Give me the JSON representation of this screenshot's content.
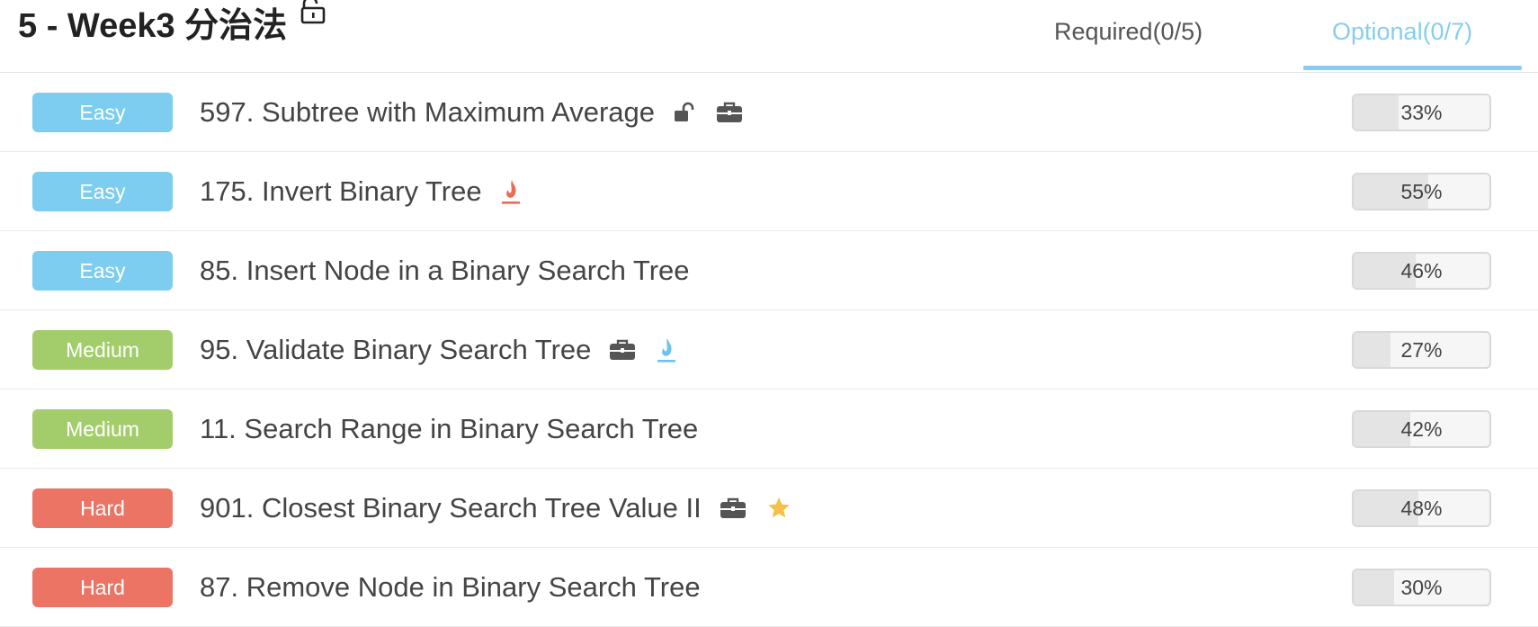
{
  "header": {
    "title": "5 - Week3 分治法",
    "tabs": [
      {
        "label": "Required(0/5)",
        "active": false
      },
      {
        "label": "Optional(0/7)",
        "active": true
      }
    ]
  },
  "colors": {
    "easy": "#7ccdf0",
    "medium": "#a2cd6a",
    "hard": "#ec7464",
    "accent": "#86cdf0",
    "flame_red": "#ec6a58",
    "flame_blue": "#6ec3ee",
    "star": "#f3c14a",
    "icon_dark": "#555555"
  },
  "problems": [
    {
      "difficulty": "Easy",
      "title": "597. Subtree with Maximum Average",
      "icons": [
        "lock-open-icon",
        "briefcase-icon"
      ],
      "acceptance": "33%",
      "acceptance_value": 0.33
    },
    {
      "difficulty": "Easy",
      "title": "175. Invert Binary Tree",
      "icons": [
        "flame-red-icon"
      ],
      "acceptance": "55%",
      "acceptance_value": 0.55
    },
    {
      "difficulty": "Easy",
      "title": "85. Insert Node in a Binary Search Tree",
      "icons": [],
      "acceptance": "46%",
      "acceptance_value": 0.46
    },
    {
      "difficulty": "Medium",
      "title": "95. Validate Binary Search Tree",
      "icons": [
        "briefcase-icon",
        "flame-blue-icon"
      ],
      "acceptance": "27%",
      "acceptance_value": 0.27
    },
    {
      "difficulty": "Medium",
      "title": "11. Search Range in Binary Search Tree",
      "icons": [],
      "acceptance": "42%",
      "acceptance_value": 0.42
    },
    {
      "difficulty": "Hard",
      "title": "901. Closest Binary Search Tree Value II",
      "icons": [
        "briefcase-icon",
        "star-icon"
      ],
      "acceptance": "48%",
      "acceptance_value": 0.48
    },
    {
      "difficulty": "Hard",
      "title": "87. Remove Node in Binary Search Tree",
      "icons": [],
      "acceptance": "30%",
      "acceptance_value": 0.3
    }
  ]
}
